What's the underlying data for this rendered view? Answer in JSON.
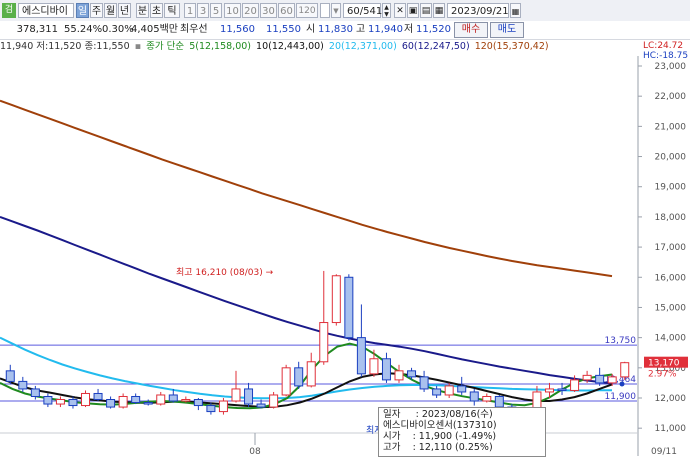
{
  "toolbar": {
    "stock_name": "에스디바이",
    "period_tabs": [
      "일",
      "주",
      "월",
      "년",
      "분",
      "초",
      "틱"
    ],
    "intervals": [
      "1",
      "3",
      "5",
      "10",
      "20",
      "30",
      "60",
      "120"
    ],
    "count_field": "60/541",
    "date_field": "2023/09/21"
  },
  "infobar": {
    "volume": "378,311",
    "pct1": "55.24%",
    "pct2": "0.30%",
    "amount": "4,405백만",
    "best_label": "최우선",
    "ask": "11,560",
    "bid": "11,550",
    "open_label": "시",
    "open": "11,830",
    "high_label": "고",
    "high": "11,940",
    "low_label": "저",
    "low": "11,520",
    "buy_btn": "매수",
    "sell_btn": "매도"
  },
  "legend": {
    "ohlc": "11,940 저:11,520 종:11,550",
    "ma_label": "종가 단순",
    "ma5": "5(12,158,00)",
    "ma10": "10(12,443,00)",
    "ma20": "20(12,371,00)",
    "ma60": "60(12,247,50)",
    "ma120": "120(15,370,42)"
  },
  "right": {
    "lc": "LC:24.72",
    "hc": "HC:-18.75"
  },
  "colors": {
    "ma5": "#1f8a1f",
    "ma10": "#111111",
    "ma20": "#22bbee",
    "ma60": "#1a1a8a",
    "ma120": "#a0400a",
    "up": "#e0303a",
    "down": "#1a3fc0"
  },
  "chart_data": {
    "type": "line",
    "y_ticks": [
      "23,000",
      "22,000",
      "21,000",
      "20,000",
      "19,000",
      "18,000",
      "17,000",
      "16,000",
      "15,000",
      "14,000",
      "13,000",
      "12,000",
      "11,000",
      "10,000"
    ],
    "ylim": [
      10000,
      23000
    ],
    "x_labels": [
      "08",
      "09/11"
    ],
    "annotation_high": "최고 16,210 (08/03)",
    "annotation_low": "최저",
    "levels": [
      {
        "value": 13750,
        "label": "13,750"
      },
      {
        "value": 12464,
        "label": "12,464"
      },
      {
        "value": 11900,
        "label": "11,900"
      }
    ],
    "current_price": "13,170",
    "current_pct": "2.97%",
    "series": [
      {
        "name": "120",
        "color": "#a0400a",
        "values": [
          21850,
          21700,
          21550,
          21400,
          21250,
          21100,
          20950,
          20800,
          20650,
          20500,
          20350,
          20200,
          20050,
          19900,
          19760,
          19620,
          19480,
          19340,
          19200,
          19060,
          18920,
          18780,
          18650,
          18520,
          18390,
          18260,
          18130,
          18000,
          17870,
          17740,
          17620,
          17500,
          17390,
          17280,
          17170,
          17070,
          16970,
          16880,
          16790,
          16700,
          16620,
          16540,
          16470,
          16400,
          16340,
          16280,
          16220,
          16160,
          16100,
          16040
        ]
      },
      {
        "name": "60",
        "color": "#1a1a8a",
        "values": [
          18000,
          17850,
          17700,
          17550,
          17390,
          17230,
          17070,
          16910,
          16750,
          16590,
          16430,
          16270,
          16110,
          15960,
          15810,
          15660,
          15510,
          15360,
          15210,
          15070,
          14930,
          14790,
          14650,
          14520,
          14400,
          14280,
          14160,
          14060,
          13970,
          13890,
          13820,
          13760,
          13700,
          13630,
          13550,
          13460,
          13370,
          13280,
          13200,
          13120,
          13040,
          12970,
          12900,
          12830,
          12760,
          12700,
          12640,
          12580,
          12530,
          12480
        ]
      },
      {
        "name": "20",
        "color": "#22bbee",
        "values": [
          14000,
          13800,
          13600,
          13420,
          13260,
          13110,
          12980,
          12860,
          12750,
          12650,
          12560,
          12480,
          12400,
          12330,
          12260,
          12200,
          12140,
          12090,
          12050,
          12020,
          12000,
          11990,
          11990,
          12000,
          12030,
          12080,
          12150,
          12220,
          12280,
          12330,
          12370,
          12400,
          12420,
          12430,
          12430,
          12420,
          12400,
          12380,
          12360,
          12340,
          12320,
          12300,
          12290,
          12280,
          12270,
          12260,
          12250,
          12250,
          12255,
          12260
        ]
      },
      {
        "name": "10",
        "color": "#111111",
        "values": [
          12650,
          12500,
          12350,
          12250,
          12180,
          12100,
          12020,
          11960,
          11920,
          11880,
          11860,
          11840,
          11840,
          11860,
          11880,
          11880,
          11850,
          11820,
          11790,
          11760,
          11730,
          11700,
          11710,
          11760,
          11850,
          11980,
          12150,
          12350,
          12550,
          12700,
          12780,
          12820,
          12800,
          12750,
          12680,
          12600,
          12510,
          12420,
          12330,
          12230,
          12130,
          12030,
          11950,
          11900,
          11900,
          11950,
          12030,
          12150,
          12300,
          12450
        ]
      },
      {
        "name": "5",
        "color": "#1f8a1f",
        "values": [
          12500,
          12300,
          12150,
          12050,
          11980,
          11920,
          11860,
          11820,
          11790,
          11780,
          11800,
          11840,
          11880,
          11900,
          11880,
          11840,
          11790,
          11740,
          11700,
          11670,
          11660,
          11690,
          11800,
          12000,
          12400,
          12950,
          13400,
          13700,
          13800,
          13700,
          13450,
          13150,
          12850,
          12600,
          12400,
          12260,
          12150,
          12060,
          11990,
          11920,
          11850,
          11780,
          11760,
          11840,
          12020,
          12280,
          12500,
          12650,
          12720,
          12780
        ]
      }
    ],
    "candles": [
      {
        "o": 12900,
        "c": 12550,
        "h": 13100,
        "l": 12450
      },
      {
        "o": 12550,
        "c": 12300,
        "h": 12700,
        "l": 12200
      },
      {
        "o": 12300,
        "c": 12050,
        "h": 12400,
        "l": 11950
      },
      {
        "o": 12050,
        "c": 11800,
        "h": 12150,
        "l": 11700
      },
      {
        "o": 11800,
        "c": 11950,
        "h": 12050,
        "l": 11700
      },
      {
        "o": 11950,
        "c": 11750,
        "h": 12050,
        "l": 11650
      },
      {
        "o": 11750,
        "c": 12150,
        "h": 12250,
        "l": 11700
      },
      {
        "o": 12150,
        "c": 11950,
        "h": 12300,
        "l": 11900
      },
      {
        "o": 11950,
        "c": 11700,
        "h": 12050,
        "l": 11650
      },
      {
        "o": 11700,
        "c": 12050,
        "h": 12150,
        "l": 11650
      },
      {
        "o": 12050,
        "c": 11850,
        "h": 12150,
        "l": 11800
      },
      {
        "o": 11850,
        "c": 11800,
        "h": 11950,
        "l": 11750
      },
      {
        "o": 11800,
        "c": 12100,
        "h": 12200,
        "l": 11750
      },
      {
        "o": 12100,
        "c": 11900,
        "h": 12300,
        "l": 11850
      },
      {
        "o": 11900,
        "c": 11950,
        "h": 12050,
        "l": 11850
      },
      {
        "o": 11950,
        "c": 11750,
        "h": 12000,
        "l": 11600
      },
      {
        "o": 11750,
        "c": 11550,
        "h": 11850,
        "l": 11450
      },
      {
        "o": 11550,
        "c": 11900,
        "h": 12000,
        "l": 11450
      },
      {
        "o": 11900,
        "c": 12300,
        "h": 12900,
        "l": 11850
      },
      {
        "o": 12300,
        "c": 11800,
        "h": 12500,
        "l": 11700
      },
      {
        "o": 11800,
        "c": 11700,
        "h": 11950,
        "l": 11650
      },
      {
        "o": 11700,
        "c": 12100,
        "h": 12200,
        "l": 11650
      },
      {
        "o": 12100,
        "c": 13000,
        "h": 13100,
        "l": 12050
      },
      {
        "o": 13000,
        "c": 12400,
        "h": 13200,
        "l": 12300
      },
      {
        "o": 12400,
        "c": 13200,
        "h": 13500,
        "l": 12350
      },
      {
        "o": 13200,
        "c": 14500,
        "h": 16210,
        "l": 13100
      },
      {
        "o": 14500,
        "c": 16050,
        "h": 16100,
        "l": 14400
      },
      {
        "o": 16000,
        "c": 14000,
        "h": 16100,
        "l": 13900
      },
      {
        "o": 14000,
        "c": 12800,
        "h": 15100,
        "l": 12700
      },
      {
        "o": 12800,
        "c": 13300,
        "h": 13600,
        "l": 12700
      },
      {
        "o": 13300,
        "c": 12600,
        "h": 13500,
        "l": 12500
      },
      {
        "o": 12600,
        "c": 12900,
        "h": 13100,
        "l": 12500
      },
      {
        "o": 12900,
        "c": 12700,
        "h": 13000,
        "l": 12600
      },
      {
        "o": 12700,
        "c": 12300,
        "h": 12900,
        "l": 12200
      },
      {
        "o": 12300,
        "c": 12100,
        "h": 12400,
        "l": 12000
      },
      {
        "o": 12100,
        "c": 12400,
        "h": 12500,
        "l": 12000
      },
      {
        "o": 12400,
        "c": 12200,
        "h": 12700,
        "l": 12100
      },
      {
        "o": 12200,
        "c": 11900,
        "h": 12300,
        "l": 11750
      },
      {
        "o": 11900,
        "c": 12050,
        "h": 12150,
        "l": 11850
      },
      {
        "o": 12050,
        "c": 11700,
        "h": 12100,
        "l": 11500
      },
      {
        "o": 11700,
        "c": 11400,
        "h": 11800,
        "l": 11300
      },
      {
        "o": 11400,
        "c": 11550,
        "h": 11650,
        "l": 11300
      },
      {
        "o": 11550,
        "c": 12200,
        "h": 12400,
        "l": 11500
      },
      {
        "o": 12200,
        "c": 12300,
        "h": 12500,
        "l": 12000
      },
      {
        "o": 12300,
        "c": 12250,
        "h": 12500,
        "l": 12100
      },
      {
        "o": 12250,
        "c": 12600,
        "h": 12750,
        "l": 12200
      },
      {
        "o": 12600,
        "c": 12750,
        "h": 12900,
        "l": 12500
      },
      {
        "o": 12750,
        "c": 12500,
        "h": 13000,
        "l": 12400
      },
      {
        "o": 12500,
        "c": 12700,
        "h": 12800,
        "l": 12400
      },
      {
        "o": 12700,
        "c": 13170,
        "h": 13200,
        "l": 12600
      }
    ]
  },
  "tooltip": {
    "date_label": "일자",
    "date_value": ": 2023/08/16(수)",
    "name": "에스디바이오센서(137310)",
    "open_label": "시가",
    "open_value": ": 11,900 (-1.49%)",
    "high_label": "고가",
    "high_value": ": 12,110 (0.25%)"
  }
}
